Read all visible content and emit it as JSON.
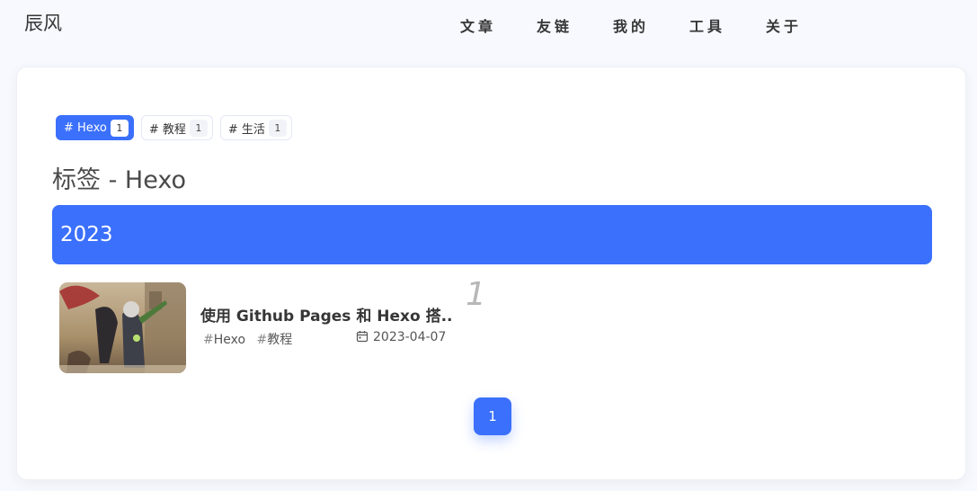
{
  "site": {
    "title": "辰风"
  },
  "nav": {
    "items": [
      "文章",
      "友链",
      "我的",
      "工具",
      "关于"
    ]
  },
  "tag_bar": {
    "tags": [
      {
        "label": "# Hexo",
        "count": "1",
        "active": true
      },
      {
        "label": "# 教程",
        "count": "1",
        "active": false
      },
      {
        "label": "# 生活",
        "count": "1",
        "active": false
      }
    ]
  },
  "page": {
    "title": "标签 - Hexo"
  },
  "archive": {
    "year": "2023",
    "posts": [
      {
        "title": "使用 Github Pages 和 Hexo 搭...",
        "tags": [
          "Hexo",
          "教程"
        ],
        "tag_hash": "#",
        "date": "2023-04-07",
        "index": "1"
      }
    ]
  },
  "pagination": {
    "current": "1"
  },
  "colors": {
    "accent": "#3b70fc",
    "background": "#f7f9fe",
    "card": "#ffffff"
  },
  "icons": {
    "date": "calendar-icon"
  }
}
